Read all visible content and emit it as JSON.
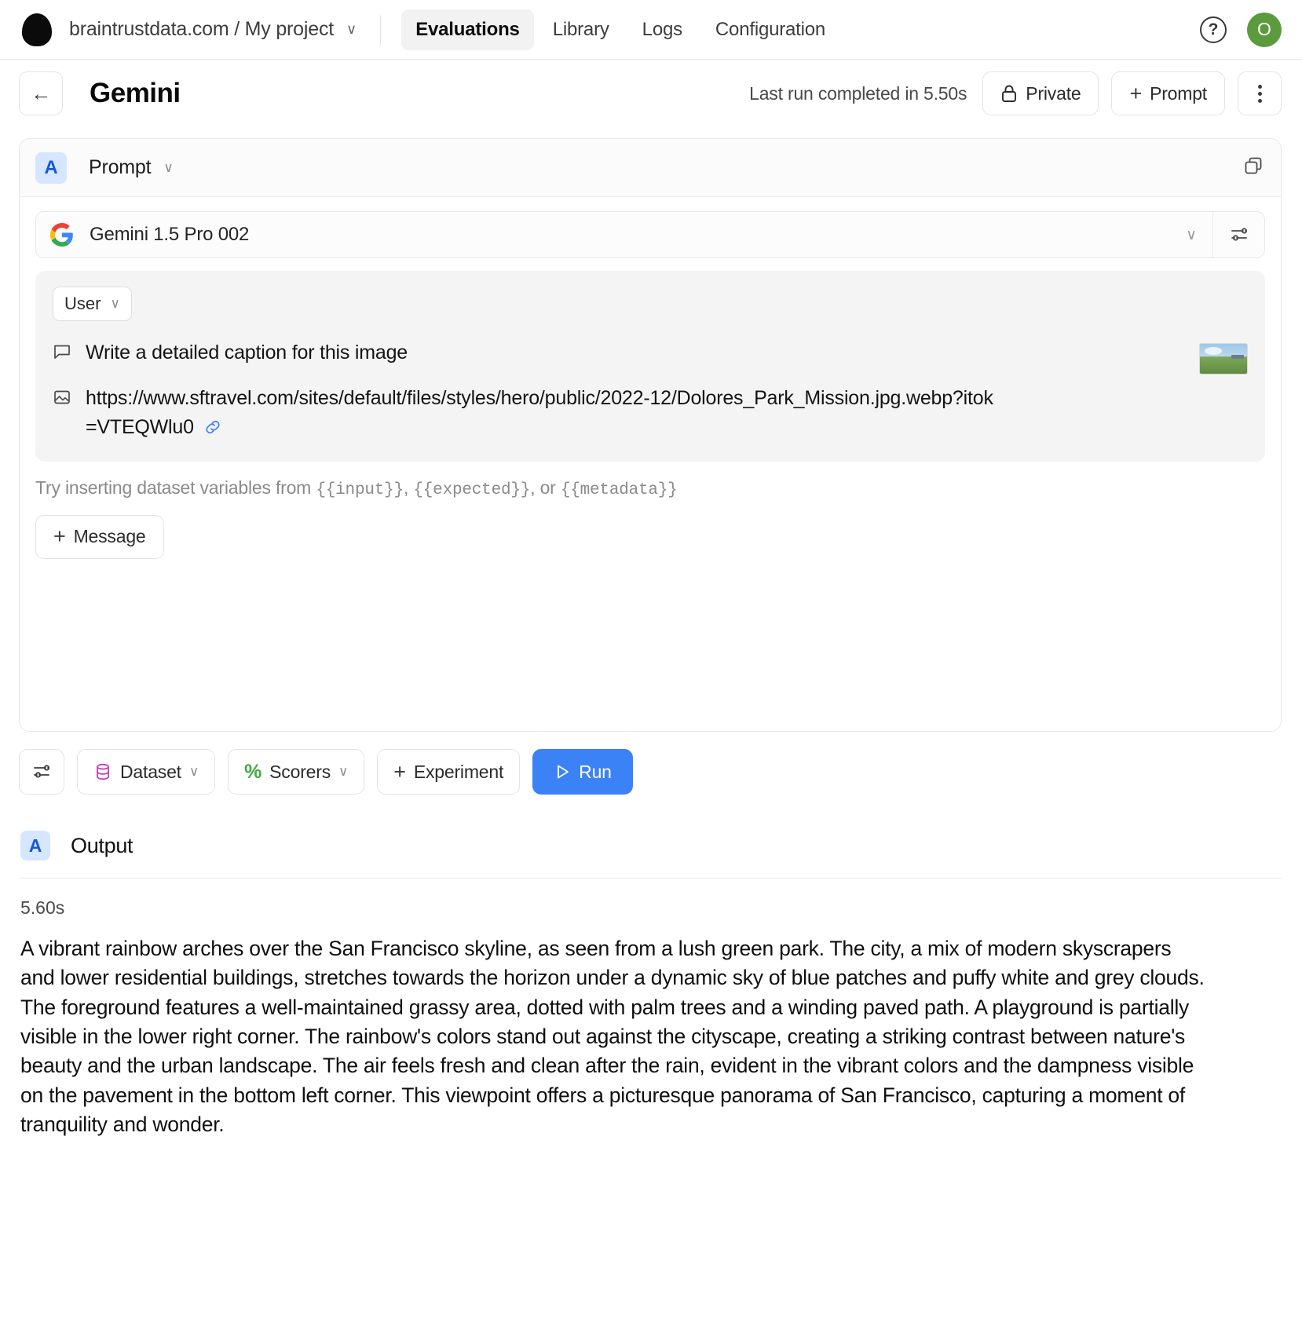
{
  "topbar": {
    "logo_icon": "braintrust-logo-icon",
    "breadcrumb": "braintrustdata.com / My project",
    "breadcrumb_caret": "∨",
    "nav_items": [
      {
        "label": "Evaluations",
        "active": true
      },
      {
        "label": "Library",
        "active": false
      },
      {
        "label": "Logs",
        "active": false
      },
      {
        "label": "Configuration",
        "active": false
      }
    ],
    "help_icon": "?",
    "avatar_initial": "O",
    "avatar_color": "#5b9b3e"
  },
  "pagehead": {
    "back_icon": "←",
    "title": "Gemini",
    "last_run": "Last run completed in 5.50s",
    "private_label": "Private",
    "prompt_label": "Prompt",
    "prompt_plus": "+"
  },
  "prompt_card": {
    "badge": "A",
    "label": "Prompt",
    "caret": "∨",
    "model": {
      "provider_icon": "google-g-icon",
      "name": "Gemini 1.5 Pro 002",
      "caret": "∨"
    },
    "message": {
      "role": "User",
      "role_caret": "∨",
      "text": "Write a detailed caption for this image",
      "url": "https://www.sftravel.com/sites/default/files/styles/hero/public/2022-12/Dolores_Park_Mission.jpg.webp?itok=VTEQWlu0",
      "link_glyph": "🔗"
    },
    "hint_prefix": "Try inserting dataset variables from ",
    "hint_var1": "{{input}}",
    "hint_mid1": ", ",
    "hint_var2": "{{expected}}",
    "hint_mid2": ", or ",
    "hint_var3": "{{metadata}}",
    "add_message_label": "Message",
    "add_message_plus": "+"
  },
  "toolbar": {
    "settings_icon": "sliders-icon",
    "dataset_label": "Dataset",
    "scorers_label": "Scorers",
    "experiment_label": "Experiment",
    "experiment_plus": "+",
    "run_label": "Run",
    "run_color": "#3b82f6"
  },
  "output": {
    "badge": "A",
    "title": "Output",
    "duration": "5.60s",
    "text": "A vibrant rainbow arches over the San Francisco skyline, as seen from a lush green park. The city, a mix of modern skyscrapers and lower residential buildings, stretches towards the horizon under a dynamic sky of blue patches and puffy white and grey clouds. The foreground features a well-maintained grassy area, dotted with palm trees and a winding paved path. A playground is partially visible in the lower right corner. The rainbow's colors stand out against the cityscape, creating a striking contrast between nature's beauty and the urban landscape. The air feels fresh and clean after the rain, evident in the vibrant colors and the dampness visible on the pavement in the bottom left corner. This viewpoint offers a picturesque panorama of San Francisco, capturing a moment of tranquility and wonder."
  }
}
